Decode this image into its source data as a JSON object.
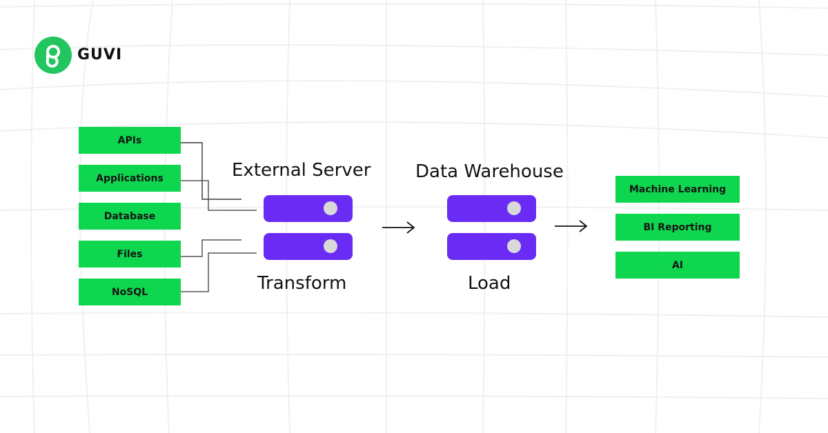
{
  "brand": {
    "name": "GUVI",
    "logo_icon": "guvi-logo-icon",
    "color": "#22c55e"
  },
  "sources": [
    "APIs",
    "Applications",
    "Database",
    "Files",
    "NoSQL"
  ],
  "stages": [
    {
      "title": "External Server",
      "caption": "Transform"
    },
    {
      "title": "Data Warehouse",
      "caption": "Load"
    }
  ],
  "destinations": [
    "Machine Learning",
    "BI Reporting",
    "AI"
  ],
  "colors": {
    "box_green": "#0fd64f",
    "server_purple": "#6a2cf5",
    "server_dot": "#d9d9d9"
  }
}
